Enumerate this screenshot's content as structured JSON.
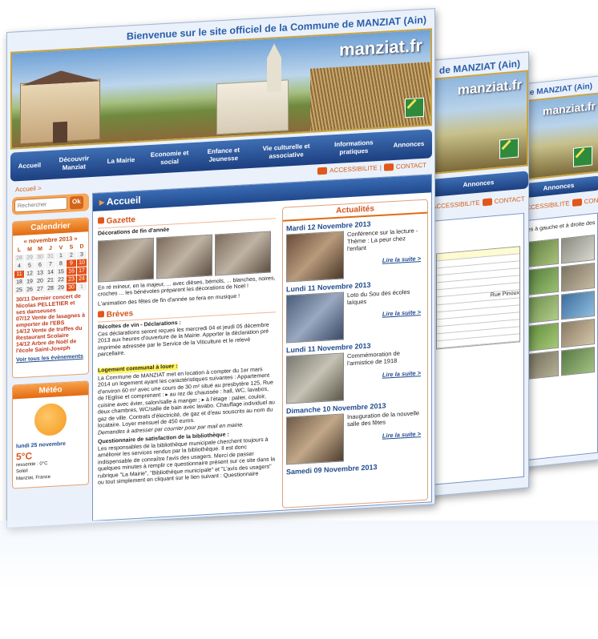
{
  "site": {
    "title": "Bienvenue sur le site officiel de la Commune de MANZIAT (Ain)",
    "title_short": "de MANZIAT (Ain)",
    "logo": "manziat.fr"
  },
  "nav": {
    "items": [
      "Accueil",
      "Découvrir Manziat",
      "La Mairie",
      "Economie et social",
      "Enfance et Jeunesse",
      "Vie culturelle et associative",
      "Informations pratiques",
      "Annonces"
    ]
  },
  "breadcrumb": "Accueil >",
  "toolbar": {
    "accessibility": "ACCESSIBILITE",
    "contact": "CONTACT"
  },
  "search": {
    "placeholder": "Rechercher",
    "button": "Ok"
  },
  "calendar": {
    "title": "Calendrier",
    "month_label": "« novembre 2013 »",
    "day_headers": [
      "L",
      "M",
      "M",
      "J",
      "V",
      "S",
      "D"
    ],
    "days": [
      "28",
      "29",
      "30",
      "31",
      "1",
      "2",
      "3",
      "4",
      "5",
      "6",
      "7",
      "8",
      "9",
      "10",
      "11",
      "12",
      "13",
      "14",
      "15",
      "16",
      "17",
      "18",
      "19",
      "20",
      "21",
      "22",
      "23",
      "24",
      "25",
      "26",
      "27",
      "28",
      "29",
      "30",
      "1"
    ],
    "events": [
      "30/11 Dernier concert de Nicolas PELLETIER et ses danseuses",
      "07/12 Vente de lasagnes à emporter de l'EBS",
      "14/12 Vente de truffes du Restaurant Scolaire",
      "14/12 Arbre de Noël de l'école Saint-Joseph"
    ],
    "all_events": "Voir tous les évènements"
  },
  "meteo": {
    "title": "Météo",
    "date": "lundi 25 novembre",
    "temp": "5°C",
    "ressentie": "ressentie : 0°C",
    "condition": "Soleil",
    "location": "Manziat, France"
  },
  "main": {
    "title": "Accueil",
    "gazette": {
      "title": "Gazette",
      "subtitle": "Décorations de fin d'année",
      "text1": "En ré mineur, en la majeur, ... avec dièses, bémols, ... blanches, noires, croches ... les bénévoles préparent les décorations de Noël !",
      "text2": "L'animation des fêtes de fin d'année se fera en musique !"
    },
    "breves": {
      "title": "Brèves",
      "items": [
        {
          "heading": "Récoltes de vin - Déclarations :",
          "text": "Ces déclarations seront reçues les mercredi 04 et jeudi 05 décembre 2013 aux heures d'ouverture de la Mairie. Apporter la déclaration pré imprimée adressée par le Service de la Viticulture et le relevé parcellaire."
        },
        {
          "heading": "Logement communal à louer :",
          "text": "La Commune de MANZIAT met en location à compter du 1er mars 2014 un logement ayant les caractéristiques suivantes : Appartement d'environ 60 m² avec une cours de 30 m² situé au presbytère 125, Rue de l'Eglise et comprenant : ▸ au rez de chaussée : hall, WC, lavabos, cuisine avec évier, salon/salle à manger ; ▸ à l'étage : palier, couloir, deux chambres, WC/salle de bain avec lavabo. Chauffage individuel au gaz de ville. Contrats d'électricité, de gaz et d'eau souscrits au nom du locataire. Loyer mensuel de 450 euros.",
          "note": "Demandes à adresser par courrier pour par mail en mairie."
        },
        {
          "heading": "Questionnaire de satisfaction de la bibliothèque :",
          "text": "Les responsables de la bibliothèque municipale cherchent toujours à améliorer les services rendus par la bibliothèque. Il est donc indispensable de connaître l'avis des usagers. Merci de passer quelques minutes à remplir ce questionnaire présent sur ce site dans la rubrique \"La Mairie\", \"Bibliothèque municipale\" et \"L'avis des usagers\" ou tout simplement en cliquant sur le lien suivant : Questionnaire"
        }
      ]
    }
  },
  "actualites": {
    "title": "Actualités",
    "more_label": "Lire la suite >",
    "items": [
      {
        "date": "Mardi 12 Novembre 2013",
        "text": "Conférence sur la lecture - Thème : La peur chez l'enfant"
      },
      {
        "date": "Lundi 11 Novembre 2013",
        "text": "Loto du Sou des écoles laïques"
      },
      {
        "date": "Lundi 11 Novembre 2013",
        "text": "Commémoration de l'armistice de 1918"
      },
      {
        "date": "Dimanche 10 Novembre 2013",
        "text": "Inauguration de la nouvelle salle des fêtes"
      },
      {
        "date": "Samedi 09 Novembre 2013",
        "text": ""
      }
    ]
  },
  "back_pages": {
    "page2_road": "Rue Pinoux",
    "page3_caption": "hes à gauche et à droite des"
  }
}
